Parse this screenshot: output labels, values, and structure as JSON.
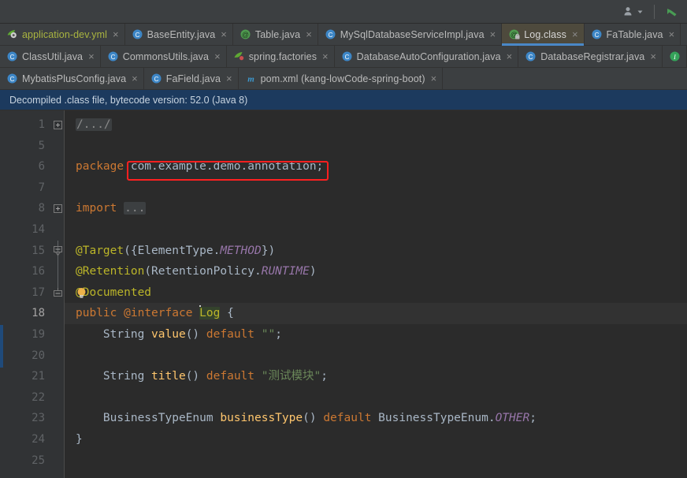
{
  "toolbar": {
    "user_icon": "user-dropdown-icon",
    "chevron": "dropdown-arrow",
    "vcs_icon": "vcs-update-arrow-icon"
  },
  "tabs": {
    "rows": [
      [
        {
          "label": "application-dev.yml",
          "icon": "spring-yaml-icon",
          "kind": "yml",
          "active": false
        },
        {
          "label": "BaseEntity.java",
          "icon": "java-class-icon",
          "kind": "class",
          "active": false
        },
        {
          "label": "Table.java",
          "icon": "java-annotation-icon",
          "kind": "annotation",
          "active": false
        },
        {
          "label": "MySqlDatabaseServiceImpl.java",
          "icon": "java-class-icon",
          "kind": "class",
          "active": false
        },
        {
          "label": "Log.class",
          "icon": "java-annotation-locked-icon",
          "kind": "annotation-locked",
          "active": true
        },
        {
          "label": "FaTable.java",
          "icon": "java-class-icon",
          "kind": "class",
          "active": false
        }
      ],
      [
        {
          "label": "ClassUtil.java",
          "icon": "java-class-icon",
          "kind": "class",
          "active": false
        },
        {
          "label": "CommonsUtils.java",
          "icon": "java-class-icon",
          "kind": "class",
          "active": false
        },
        {
          "label": "spring.factories",
          "icon": "spring-factories-icon",
          "kind": "spring",
          "active": false
        },
        {
          "label": "DatabaseAutoConfiguration.java",
          "icon": "java-class-icon",
          "kind": "class",
          "active": false
        },
        {
          "label": "DatabaseRegistrar.java",
          "icon": "java-class-icon",
          "kind": "class",
          "active": false
        },
        {
          "label": "",
          "icon": "java-interface-icon",
          "kind": "interface",
          "active": false
        }
      ],
      [
        {
          "label": "MybatisPlusConfig.java",
          "icon": "java-class-icon",
          "kind": "class",
          "active": false
        },
        {
          "label": "FaField.java",
          "icon": "java-class-icon",
          "kind": "class",
          "active": false
        },
        {
          "label": "pom.xml (kang-lowCode-spring-boot)",
          "icon": "maven-icon",
          "kind": "maven",
          "active": false
        }
      ]
    ],
    "close_glyph": "×"
  },
  "banner": {
    "text": "Decompiled .class file, bytecode version: 52.0 (Java 8)"
  },
  "editor": {
    "line_numbers": [
      "1",
      "5",
      "6",
      "7",
      "8",
      "14",
      "15",
      "16",
      "17",
      "18",
      "19",
      "20",
      "21",
      "22",
      "23",
      "24",
      "25"
    ],
    "current_line_number": "18",
    "fold_placeholder_comment": "/.../",
    "fold_placeholder_import": "...",
    "lines": {
      "l1_comment": "/.../",
      "l6_keyword": "package",
      "l6_package": "com.example.demo.annotation;",
      "l8_keyword": "import",
      "l15_anno": "@Target",
      "l15_open": "({ElementType.",
      "l15_const": "METHOD",
      "l15_close": "})",
      "l16_anno": "@Retention",
      "l16_open": "(RetentionPolicy.",
      "l16_const": "RUNTIME",
      "l16_close": ")",
      "l17_anno": "@Documented",
      "l18_kw1": "public",
      "l18_kw2": "@interface",
      "l18_name": "Log",
      "l18_brace": "{",
      "l19_type": "String",
      "l19_meth": "value",
      "l19_parens": "()",
      "l19_kw": "default",
      "l19_str": "\"\"",
      "l19_semi": ";",
      "l21_type": "String",
      "l21_meth": "title",
      "l21_parens": "()",
      "l21_kw": "default",
      "l21_str": "\"测试模块\"",
      "l21_semi": ";",
      "l23_type": "BusinessTypeEnum",
      "l23_meth": "businessType",
      "l23_parens": "()",
      "l23_kw": "default",
      "l23_enum": "BusinessTypeEnum.",
      "l23_const": "OTHER",
      "l23_semi": ";",
      "l24_brace": "}"
    },
    "annotation_box": {
      "color": "#ff2020",
      "target": "package-name"
    },
    "intention_bulb": "lightbulb-icon"
  },
  "colors": {
    "editor_bg": "#2b2b2b",
    "gutter_bg": "#313335",
    "panel_bg": "#3c3f41",
    "active_tab_bg": "#4e4a3d",
    "active_tab_underline": "#4a88c7",
    "banner_bg": "#1c3a5e",
    "keyword": "#cc7832",
    "annotation": "#bbb529",
    "constant": "#9876aa",
    "string": "#6a8759",
    "method": "#ffc66d",
    "text": "#a9b7c6",
    "highlight_box": "#ff2020"
  }
}
